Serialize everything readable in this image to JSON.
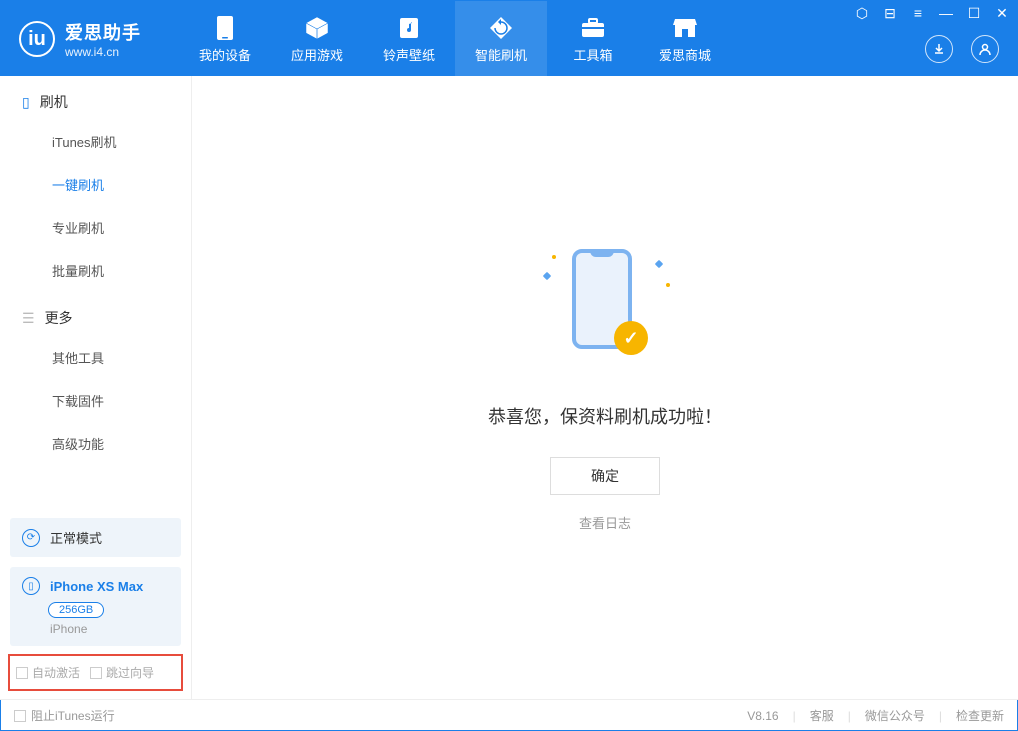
{
  "logo": {
    "title": "爱思助手",
    "url": "www.i4.cn"
  },
  "nav": [
    {
      "label": "我的设备"
    },
    {
      "label": "应用游戏"
    },
    {
      "label": "铃声壁纸"
    },
    {
      "label": "智能刷机"
    },
    {
      "label": "工具箱"
    },
    {
      "label": "爱思商城"
    }
  ],
  "sidebar": {
    "section1_title": "刷机",
    "items1": [
      {
        "label": "iTunes刷机"
      },
      {
        "label": "一键刷机"
      },
      {
        "label": "专业刷机"
      },
      {
        "label": "批量刷机"
      }
    ],
    "section2_title": "更多",
    "items2": [
      {
        "label": "其他工具"
      },
      {
        "label": "下载固件"
      },
      {
        "label": "高级功能"
      }
    ],
    "mode_label": "正常模式",
    "device": {
      "name": "iPhone XS Max",
      "storage": "256GB",
      "type": "iPhone"
    },
    "cb1": "自动激活",
    "cb2": "跳过向导"
  },
  "main": {
    "success": "恭喜您，保资料刷机成功啦！",
    "ok": "确定",
    "log": "查看日志"
  },
  "footer": {
    "block_itunes": "阻止iTunes运行",
    "version": "V8.16",
    "links": [
      "客服",
      "微信公众号",
      "检查更新"
    ]
  }
}
